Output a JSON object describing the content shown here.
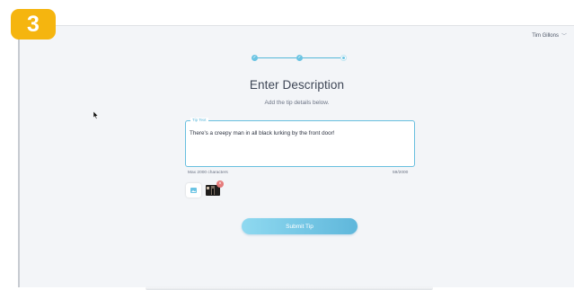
{
  "badge": {
    "number": "3"
  },
  "header": {
    "user_name": "Tim Gillons",
    "chevron": "chevron-down-icon"
  },
  "stepper": {
    "steps": [
      "✓",
      "✓",
      ""
    ]
  },
  "page": {
    "title": "Enter Description",
    "subtitle": "Add the tip details below."
  },
  "tip_field": {
    "label": "Tip Text",
    "value": "There's a creepy man in all black lurking by the front door!",
    "helper_left": "Max 2000 characters",
    "counter": "59/2000"
  },
  "attachments": {
    "add_icon": "image-icon",
    "remove_label": "×"
  },
  "actions": {
    "submit_label": "Submit Tip"
  },
  "colors": {
    "accent": "#5fb7db",
    "badge": "#f5b50f",
    "remove": "#e57a7a"
  }
}
